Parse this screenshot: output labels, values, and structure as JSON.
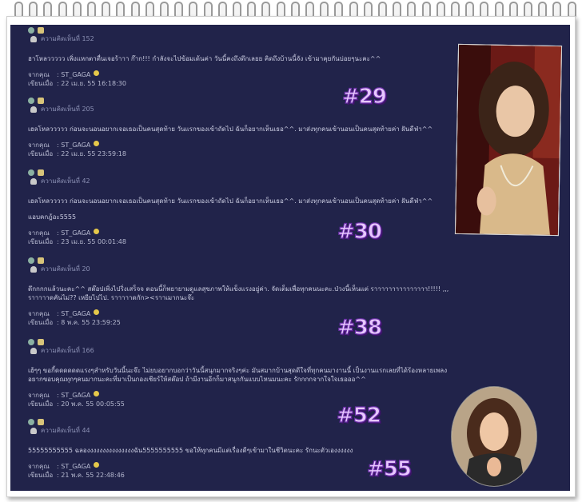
{
  "posts": [
    {
      "view_count": "ความคิดเห็นที่ 152",
      "message": "ฮาโหลววววว เพิ่งแหกตาตื่นเจอร้าาา ก๊าก!!! กำลังจะไปข้อมเด้นค่า วันนี้คงถึงดึกเลยย คิดถึงบ้านนี้จัง เข้ามาคุยกันบ่อยๆนะคะ^^",
      "author_label": "จากคุณ",
      "author": ": ST_GAGA",
      "time_label": "เขียนเมื่อ",
      "time": ": 22 เม.ย. 55 16:18:30"
    },
    {
      "view_count": "ความคิดเห็นที่ 205",
      "message": "เฮลโหลววววว ก่อนจะนอนอยากเจอเธอเป็นคนสุดท้าย วันแรกของเข้าถัดไป ฉันก็อยากเห็นเธอ^^. มาส่งทุกคนเข้านอนเป็นคนสุดท้ายค่า ฝันดีฟ่า^^",
      "author_label": "จากคุณ",
      "author": ": ST_GAGA",
      "time_label": "เขียนเมื่อ",
      "time": ": 22 เม.ย. 55 23:59:18"
    },
    {
      "view_count": "ความคิดเห็นที่ 42",
      "message": "เฮลโหลววววว ก่อนจะนอนอยากเจอเธอเป็นคนสุดท้าย วันแรกของเข้าถัดไป ฉันก็อยากเห็นเธอ^^. มาส่งทุกคนเข้านอนเป็นคนสุดท้ายค่า ฝันดีฟ่า^^",
      "message2": "แอบคกฎ้อะ5555",
      "author_label": "จากคุณ",
      "author": ": ST_GAGA",
      "time_label": "เขียนเมื่อ",
      "time": ": 23 เม.ย. 55 00:01:48"
    },
    {
      "view_count": "ความคิดเห็นที่ 20",
      "message": "ดึกกกกแล้วนะคะ^^ สต๊อปเพิ่งไปริ่งเสร็จจ ตอนนี้ก็พยายามดูแลสุขภาพให้แข็งแรงอยู่ค่า. จัดเต็มเพื่อทุกคนนะคะ.ป่วงนี้เห็นแต่ ราาาาาาาาาาาาาาา!!!!! ,,, ราาาาาดคันไม่?? เหยียไปไป. ราาาาาดกัก><ราาเมากนะจ๊ะ",
      "author_label": "จากคุณ",
      "author": ": ST_GAGA",
      "time_label": "เขียนเมื่อ",
      "time": ": 8 พ.ค. 55 23:59:25"
    },
    {
      "view_count": "ความคิดเห็นที่ 166",
      "message": "เฮ้ๆๆ ขอกี้ดดดดดดแรงๆสำหรับวันนี้นะจ๊ะ ไม่ยบอยากบอกว่าวันนี้สนุกมากจริงๆค่ะ มันสมากบ้านสุดดีใจที่ทุกคนมางานนี้ เป็นงานแรกเลยที่ได้ร้องหลายเพลง อยากขอบคุณทุกๆคนมากนะคะที่มาเป็นกองเชียร์ให้สต๊อป ถ้ามีงานอีกก็มาสนุกกันแบบไหนมนะคะ รักกกกจากใจใจเธอออ^^",
      "author_label": "จากคุณ",
      "author": ": ST_GAGA",
      "time_label": "เขียนเมื่อ",
      "time": ": 20 พ.ค. 55 00:05:55"
    },
    {
      "view_count": "ความคิดเห็นที่ 44",
      "message": "55555555555 ฉลองงงงงงงงงงงงงงงฉัน5555555555 ขอให้ทุกคนมีแต่เรื่องดีๆเข้ามาในชีวิตนะคะ รักนะตัวเองงงงงง",
      "author_label": "จากคุณ",
      "author": ": ST_GAGA",
      "time_label": "เขียนเมื่อ",
      "time": ": 21 พ.ค. 55 22:48:46"
    }
  ],
  "tags": [
    "#29",
    "#30",
    "#38",
    "#52",
    "#55"
  ],
  "colors": {
    "board": "#21234a",
    "tag_fill": "#e8c8ff",
    "tag_stroke": "#6b2fa8"
  }
}
